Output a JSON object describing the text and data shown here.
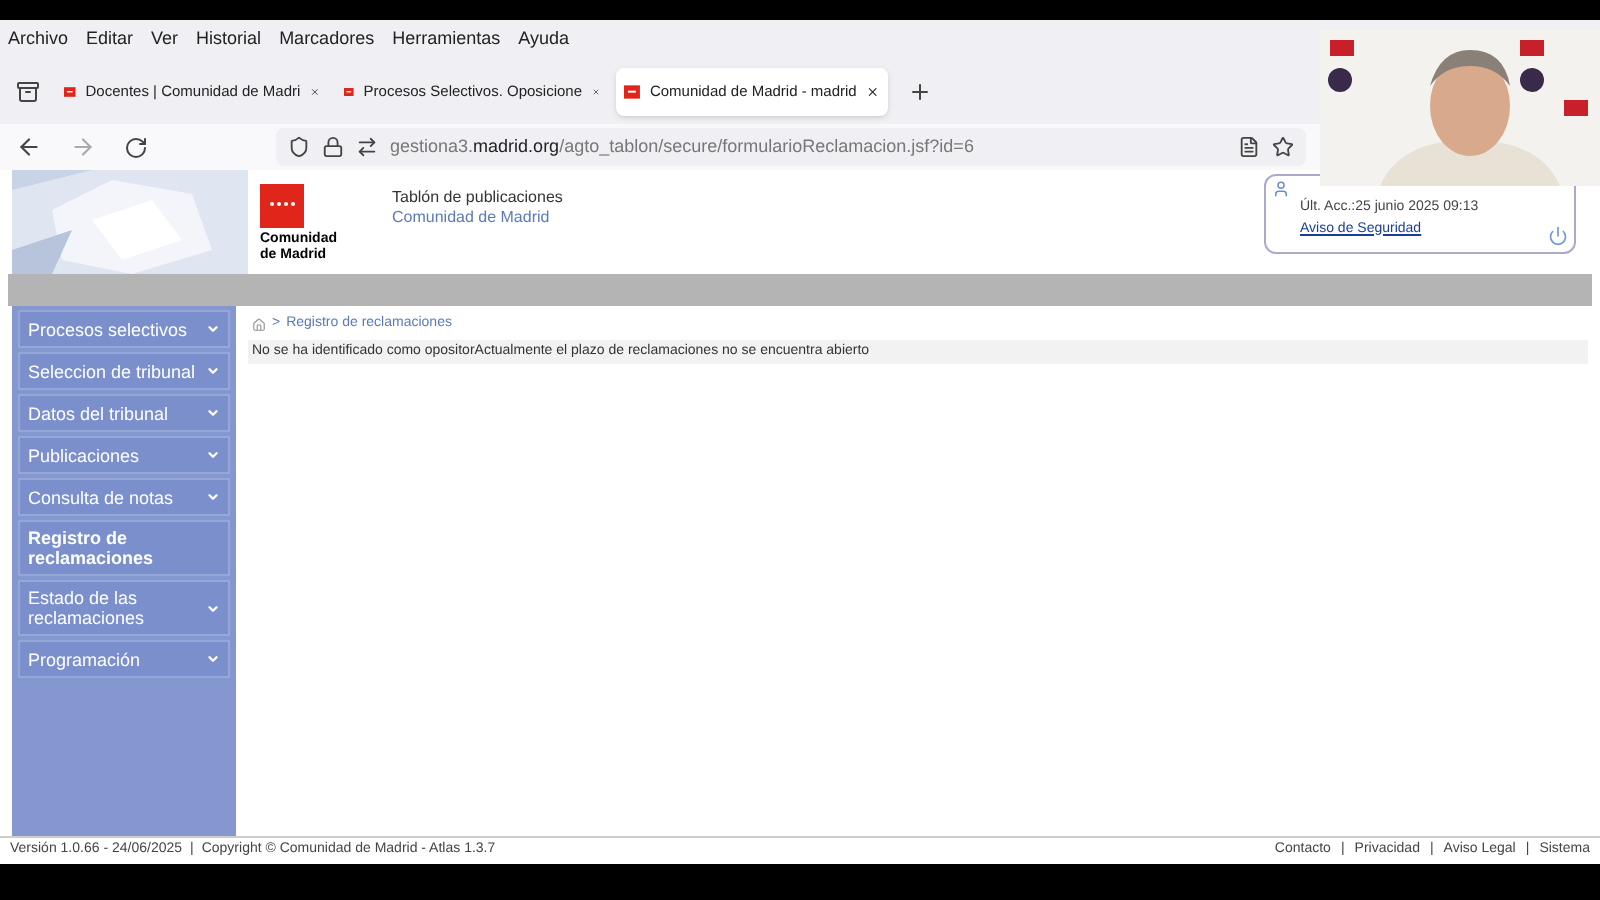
{
  "menu_bar": [
    "Archivo",
    "Editar",
    "Ver",
    "Historial",
    "Marcadores",
    "Herramientas",
    "Ayuda"
  ],
  "tabs": [
    {
      "label": "Docentes | Comunidad de Madri",
      "selected": false
    },
    {
      "label": "Procesos Selectivos. Oposicione",
      "selected": false
    },
    {
      "label": "Comunidad de Madrid - madrid",
      "selected": true
    }
  ],
  "address_bar": {
    "prefix": "gestiona3.",
    "domain": "madrid.org",
    "path": "/agto_tablon/secure/formularioReclamacion.jsf?id=6"
  },
  "header": {
    "logo_text": "Comunidad de Madrid",
    "title": "Tablón de publicaciones",
    "subtitle": "Comunidad de Madrid"
  },
  "user_card": {
    "last_access": "Últ. Acc.:25 junio 2025 09:13",
    "security_link": "Aviso de Seguridad"
  },
  "sidebar": {
    "items": [
      {
        "label": "Procesos selectivos",
        "selected": false,
        "has_submenu": true
      },
      {
        "label": "Seleccion de tribunal",
        "selected": false,
        "has_submenu": true
      },
      {
        "label": "Datos del tribunal",
        "selected": false,
        "has_submenu": true
      },
      {
        "label": "Publicaciones",
        "selected": false,
        "has_submenu": true
      },
      {
        "label": "Consulta de notas",
        "selected": false,
        "has_submenu": true
      },
      {
        "label": "Registro de reclamaciones",
        "selected": true,
        "has_submenu": false
      },
      {
        "label": "Estado de las reclamaciones",
        "selected": false,
        "has_submenu": true
      },
      {
        "label": "Programación",
        "selected": false,
        "has_submenu": true
      }
    ]
  },
  "breadcrumb": {
    "separator": ">",
    "current": "Registro de reclamaciones"
  },
  "message": "No se ha identificado como opositorActualmente el plazo de reclamaciones no se encuentra abierto",
  "footer": {
    "version": "Versión 1.0.66 - 24/06/2025",
    "copyright": "Copyright © Comunidad de Madrid - Atlas 1.3.7",
    "separator": "|",
    "links": [
      "Contacto",
      "Privacidad",
      "Aviso Legal",
      "Sistema"
    ]
  }
}
